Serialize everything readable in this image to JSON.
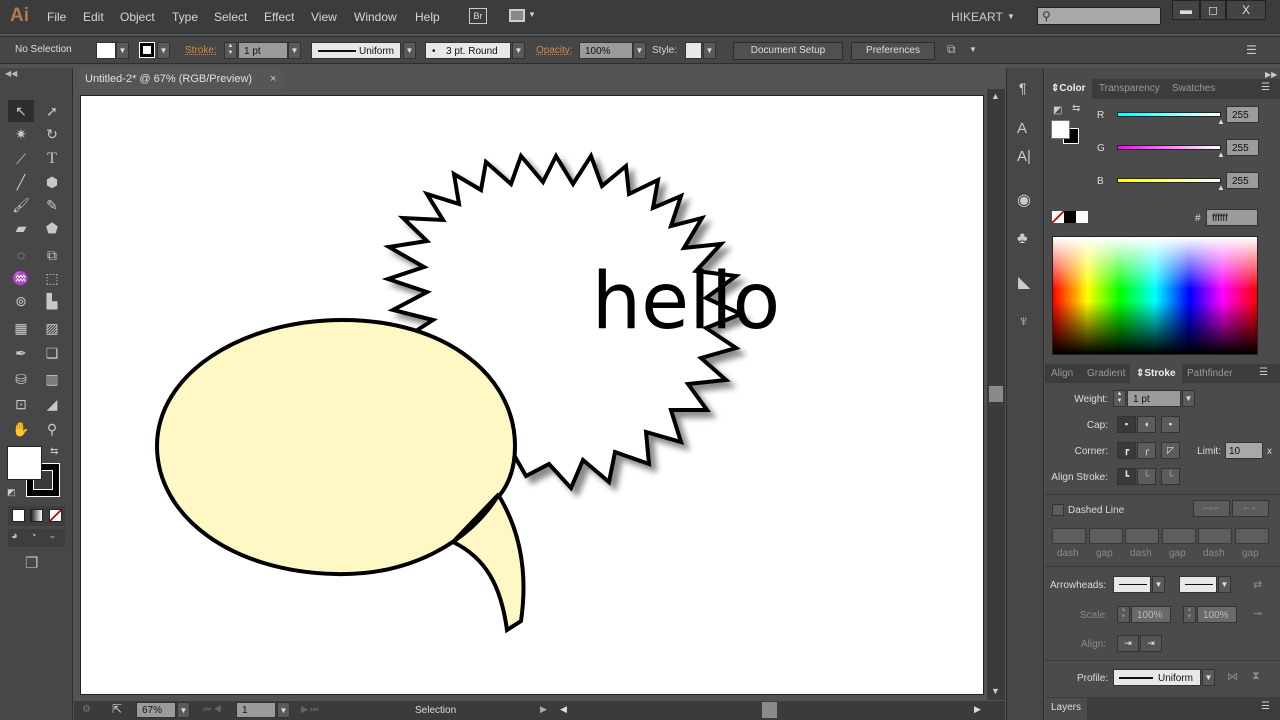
{
  "app": {
    "logo": "Ai",
    "workspace": "HIKEART",
    "search_placeholder": "",
    "window_controls": [
      "minimize",
      "maximize",
      "close"
    ]
  },
  "menu": [
    "File",
    "Edit",
    "Object",
    "Type",
    "Select",
    "Effect",
    "View",
    "Window",
    "Help"
  ],
  "menu_icons": {
    "bridge": "Br",
    "arrange": "arrange-documents-icon"
  },
  "control": {
    "selection": "No Selection",
    "stroke_label": "Stroke:",
    "stroke_weight": "1 pt",
    "stroke_profile": "Uniform",
    "brush": "3 pt. Round",
    "opacity_label": "Opacity:",
    "opacity": "100%",
    "style_label": "Style:",
    "document_setup": "Document Setup",
    "preferences": "Preferences"
  },
  "document": {
    "tab_title": "Untitled-2* @ 67% (RGB/Preview)",
    "close": "×"
  },
  "artwork": {
    "text": "hello",
    "balloon_fill": "#fff8c4",
    "burst_fill": "#ffffff",
    "stroke": "#000000"
  },
  "status": {
    "zoom": "67%",
    "page": "1",
    "tool": "Selection"
  },
  "color_panel": {
    "tabs": [
      "Color",
      "Transparency",
      "Swatches"
    ],
    "active": "Color",
    "r": "255",
    "g": "255",
    "b": "255",
    "r_label": "R",
    "g_label": "G",
    "b_label": "B",
    "hex_label": "#",
    "hex": "ffffff"
  },
  "stroke_panel": {
    "tabs": [
      "Align",
      "Gradient",
      "Stroke",
      "Pathfinder"
    ],
    "active": "Stroke",
    "weight_label": "Weight:",
    "weight": "1 pt",
    "cap_label": "Cap:",
    "corner_label": "Corner:",
    "limit_label": "Limit:",
    "limit": "10",
    "limit_unit": "x",
    "align_label": "Align Stroke:",
    "dashed_label": "Dashed Line",
    "dashed": false,
    "dash_labels": [
      "dash",
      "gap",
      "dash",
      "gap",
      "dash",
      "gap"
    ],
    "arrowheads_label": "Arrowheads:",
    "scale_label": "Scale:",
    "scale_start": "100%",
    "scale_end": "100%",
    "align2_label": "Align:",
    "profile_label": "Profile:",
    "profile": "Uniform"
  },
  "layers_panel": {
    "tab": "Layers"
  }
}
